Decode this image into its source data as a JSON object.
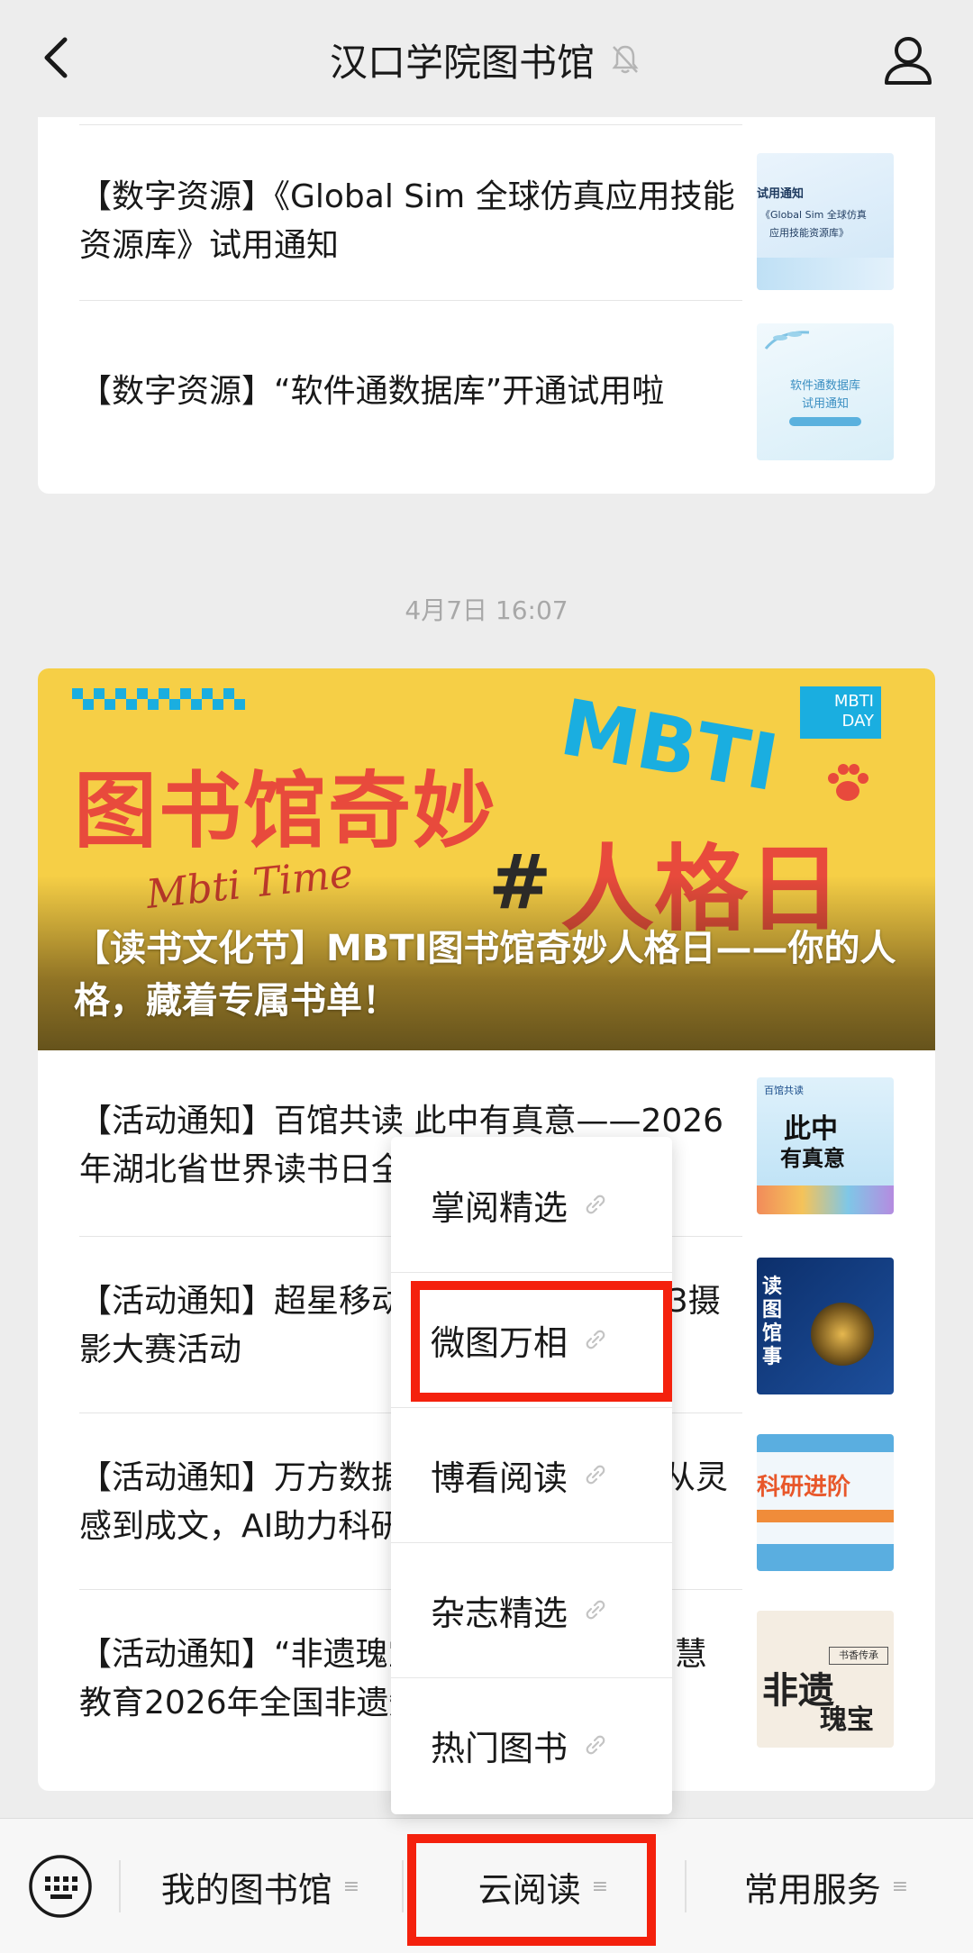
{
  "header": {
    "title": "汉口学院图书馆",
    "back_icon": "chevron-left-icon",
    "mute_icon": "bell-muted-icon",
    "profile_icon": "person-icon"
  },
  "card1": {
    "articles": [
      {
        "title": "【数字资源】《Global Sim 全球仿真应用技能资源库》试用通知",
        "thumb_lines": [
          "试用通知",
          "《Global Sim 全球仿真",
          "应用技能资源库》"
        ]
      },
      {
        "title": "【数字资源】“软件通数据库”开通试用啦",
        "thumb_lines": [
          "软件通数据库",
          "试用通知"
        ]
      }
    ]
  },
  "timestamp": "4月7日 16:07",
  "card2": {
    "banner": {
      "title": "【读书文化节】MBTI图书馆奇妙人格日——你的人格，藏着专属书单！",
      "art_text_left": "图书馆奇妙",
      "art_text_mbti": "MBTI",
      "art_text_hash": "#",
      "art_text_right": "人格日",
      "art_badge": "MBTI DAY",
      "art_script": "Mbti Time"
    },
    "articles": [
      {
        "title": "【活动通知】百馆共读 此中有真意——2026年湖北省世界读书日全民阅读活动…",
        "thumb_lines": [
          "百馆共读",
          "此中",
          "有真意"
        ]
      },
      {
        "title": "【活动通知】超星移动图书馆2026年4·23摄影大赛活动",
        "thumb_lines": [
          "读",
          "图",
          "馆",
          "事"
        ]
      },
      {
        "title": "【活动通知】万方数据科研进阶计划——从灵感到成文，AI助力科研全流程",
        "thumb_lines": [
          "科研进阶"
        ]
      },
      {
        "title": "【活动通知】“非遗瑰宝·书香传承”东方智慧教育2026年全国非遗知识竞赛…",
        "thumb_lines": [
          "书香传承",
          "非遗",
          "瑰宝"
        ]
      }
    ]
  },
  "popup_menu": {
    "items": [
      {
        "label": "掌阅精选",
        "icon": "link-icon"
      },
      {
        "label": "微图万相",
        "icon": "link-icon"
      },
      {
        "label": "博看阅读",
        "icon": "link-icon"
      },
      {
        "label": "杂志精选",
        "icon": "link-icon"
      },
      {
        "label": "热门图书",
        "icon": "link-icon"
      }
    ]
  },
  "bottom_menu": {
    "keyboard_icon": "keyboard-icon",
    "tabs": [
      {
        "label": "我的图书馆"
      },
      {
        "label": "云阅读"
      },
      {
        "label": "常用服务"
      }
    ],
    "menu_glyph": "≡"
  },
  "colors": {
    "highlight": "#f4210d",
    "banner_yellow": "#f6cf46",
    "banner_red": "#e84a3c",
    "banner_teal": "#1aaee0"
  }
}
